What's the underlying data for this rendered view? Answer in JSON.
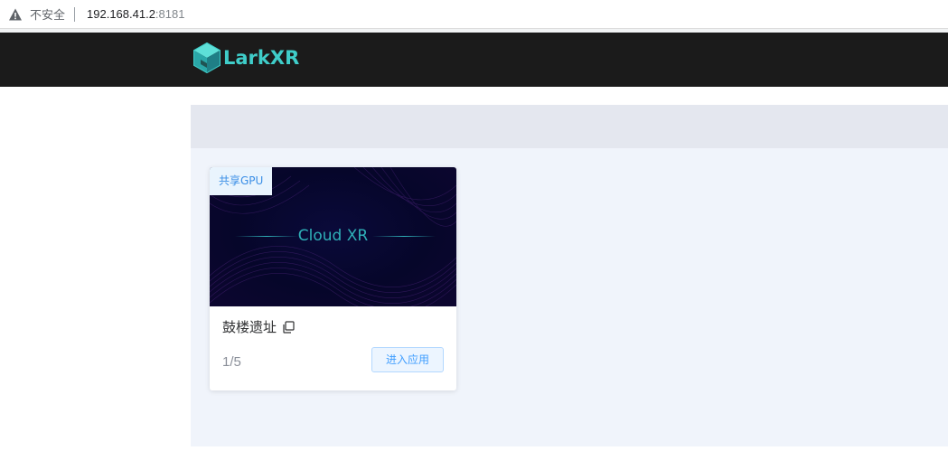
{
  "browser": {
    "security_label": "不安全",
    "url_host": "192.168.41.2",
    "url_port": ":8181"
  },
  "header": {
    "logo_text": "LarkXR",
    "brand_color": "#3fcdc9",
    "background": "#1b1b1b"
  },
  "apps": [
    {
      "badge": "共享GPU",
      "cover_title": "Cloud XR",
      "name": "鼓楼遗址",
      "count": "1/5",
      "enter_label": "进入应用"
    }
  ],
  "icons": {
    "warning": "warning-triangle-icon",
    "copy": "copy-icon",
    "logo": "larkxr-cube-logo-icon"
  },
  "colors": {
    "accent": "#409eff",
    "content_bg": "#f0f4fb",
    "content_header_bg": "#e4e7ef"
  }
}
